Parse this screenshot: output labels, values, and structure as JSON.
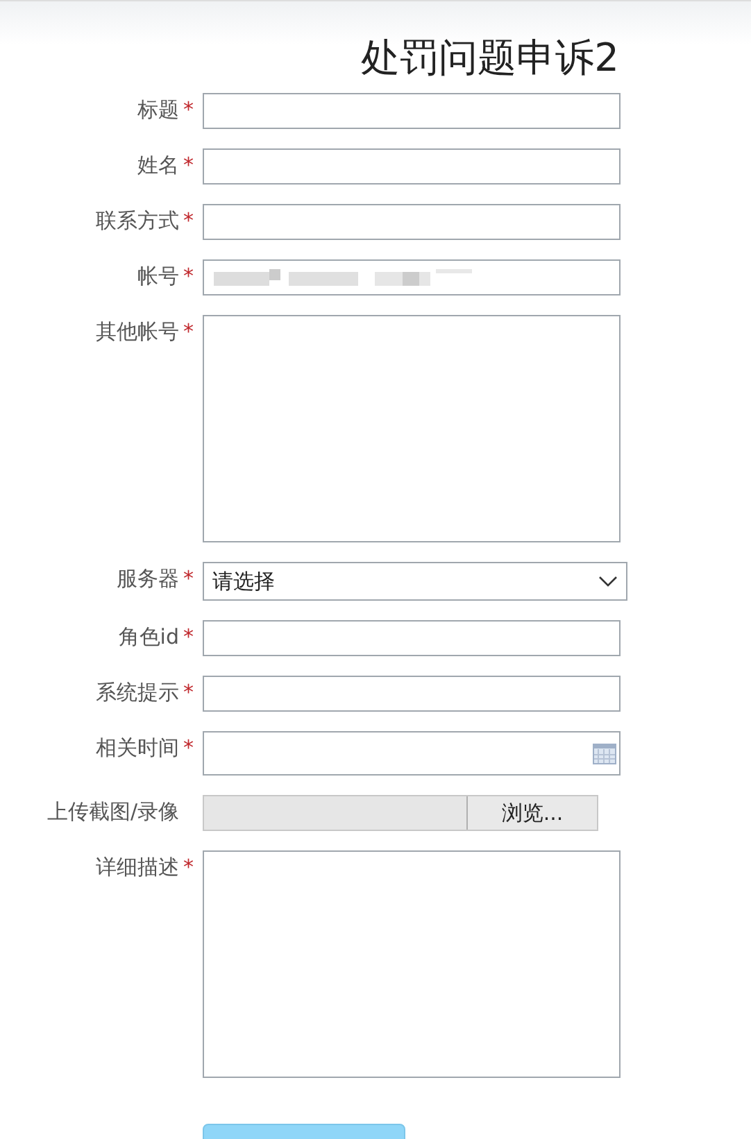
{
  "title": "处罚问题申诉2",
  "fields": [
    {
      "kind": "text",
      "label": "标题",
      "mark": "*"
    },
    {
      "kind": "text",
      "label": "姓名",
      "mark": "*"
    },
    {
      "kind": "text",
      "label": "联系方式",
      "mark": "*"
    },
    {
      "kind": "redacted",
      "label": "帐号",
      "mark": "*"
    },
    {
      "kind": "textarea",
      "label": "其他帐号",
      "mark": "*"
    },
    {
      "kind": "select",
      "label": "服务器",
      "mark": "*",
      "value": "请选择"
    },
    {
      "kind": "text",
      "label": "角色id",
      "mark": "*"
    },
    {
      "kind": "text",
      "label": "系统提示",
      "mark": "*"
    },
    {
      "kind": "date",
      "label": "相关时间",
      "mark": "*"
    },
    {
      "kind": "file",
      "label": "上传截图/录像",
      "button": "浏览..."
    },
    {
      "kind": "textarea",
      "label": "详细描述",
      "mark": "*"
    }
  ]
}
